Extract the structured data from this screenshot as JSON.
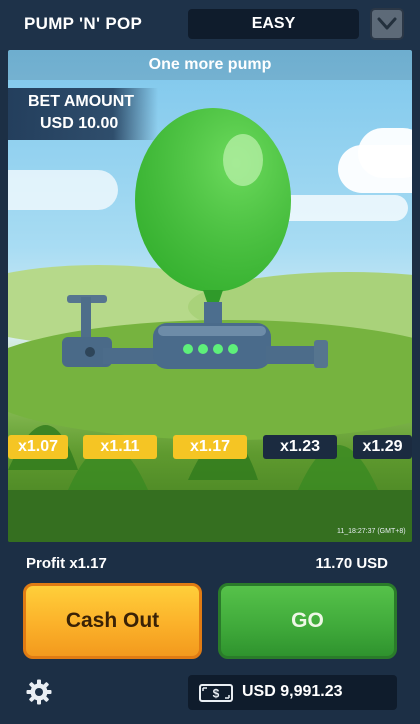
{
  "header": {
    "title": "PUMP 'N' POP",
    "difficulty": "EASY"
  },
  "game": {
    "status": "One more pump",
    "bet_label": "BET AMOUNT",
    "bet_amount": "USD 10.00",
    "multipliers": [
      {
        "label": "x1.07",
        "active": true
      },
      {
        "label": "x1.11",
        "active": true
      },
      {
        "label": "x1.17",
        "active": true
      },
      {
        "label": "x1.23",
        "active": false
      },
      {
        "label": "x1.29",
        "active": false
      }
    ],
    "timestamp": "11_18:27:37 (GMT+8)"
  },
  "controls": {
    "profit_label": "Profit x1.17",
    "profit_value": "11.70 USD",
    "cashout_label": "Cash Out",
    "go_label": "GO",
    "balance": "USD 9,991.23"
  },
  "colors": {
    "accent_yellow": "#f5c524",
    "cashout": "#fbb12a",
    "go": "#3fa93a",
    "balloon": "#43c93b",
    "panel": "#1c2f45"
  },
  "icons": [
    "chevron-down-icon",
    "gear-icon",
    "cash-icon",
    "balloon-icon",
    "pump-icon"
  ]
}
